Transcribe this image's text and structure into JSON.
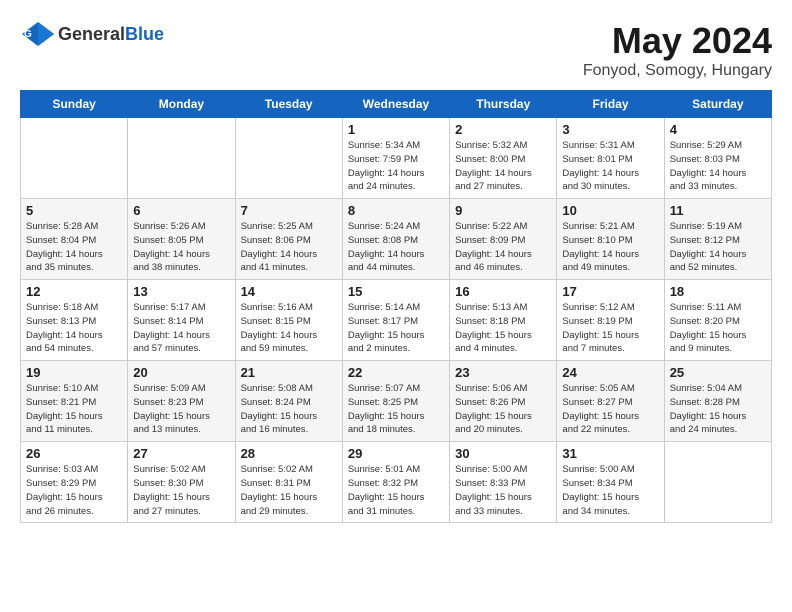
{
  "logo": {
    "general": "General",
    "blue": "Blue"
  },
  "title": "May 2024",
  "subtitle": "Fonyod, Somogy, Hungary",
  "days_of_week": [
    "Sunday",
    "Monday",
    "Tuesday",
    "Wednesday",
    "Thursday",
    "Friday",
    "Saturday"
  ],
  "weeks": [
    [
      {
        "day": "",
        "info": ""
      },
      {
        "day": "",
        "info": ""
      },
      {
        "day": "",
        "info": ""
      },
      {
        "day": "1",
        "info": "Sunrise: 5:34 AM\nSunset: 7:59 PM\nDaylight: 14 hours\nand 24 minutes."
      },
      {
        "day": "2",
        "info": "Sunrise: 5:32 AM\nSunset: 8:00 PM\nDaylight: 14 hours\nand 27 minutes."
      },
      {
        "day": "3",
        "info": "Sunrise: 5:31 AM\nSunset: 8:01 PM\nDaylight: 14 hours\nand 30 minutes."
      },
      {
        "day": "4",
        "info": "Sunrise: 5:29 AM\nSunset: 8:03 PM\nDaylight: 14 hours\nand 33 minutes."
      }
    ],
    [
      {
        "day": "5",
        "info": "Sunrise: 5:28 AM\nSunset: 8:04 PM\nDaylight: 14 hours\nand 35 minutes."
      },
      {
        "day": "6",
        "info": "Sunrise: 5:26 AM\nSunset: 8:05 PM\nDaylight: 14 hours\nand 38 minutes."
      },
      {
        "day": "7",
        "info": "Sunrise: 5:25 AM\nSunset: 8:06 PM\nDaylight: 14 hours\nand 41 minutes."
      },
      {
        "day": "8",
        "info": "Sunrise: 5:24 AM\nSunset: 8:08 PM\nDaylight: 14 hours\nand 44 minutes."
      },
      {
        "day": "9",
        "info": "Sunrise: 5:22 AM\nSunset: 8:09 PM\nDaylight: 14 hours\nand 46 minutes."
      },
      {
        "day": "10",
        "info": "Sunrise: 5:21 AM\nSunset: 8:10 PM\nDaylight: 14 hours\nand 49 minutes."
      },
      {
        "day": "11",
        "info": "Sunrise: 5:19 AM\nSunset: 8:12 PM\nDaylight: 14 hours\nand 52 minutes."
      }
    ],
    [
      {
        "day": "12",
        "info": "Sunrise: 5:18 AM\nSunset: 8:13 PM\nDaylight: 14 hours\nand 54 minutes."
      },
      {
        "day": "13",
        "info": "Sunrise: 5:17 AM\nSunset: 8:14 PM\nDaylight: 14 hours\nand 57 minutes."
      },
      {
        "day": "14",
        "info": "Sunrise: 5:16 AM\nSunset: 8:15 PM\nDaylight: 14 hours\nand 59 minutes."
      },
      {
        "day": "15",
        "info": "Sunrise: 5:14 AM\nSunset: 8:17 PM\nDaylight: 15 hours\nand 2 minutes."
      },
      {
        "day": "16",
        "info": "Sunrise: 5:13 AM\nSunset: 8:18 PM\nDaylight: 15 hours\nand 4 minutes."
      },
      {
        "day": "17",
        "info": "Sunrise: 5:12 AM\nSunset: 8:19 PM\nDaylight: 15 hours\nand 7 minutes."
      },
      {
        "day": "18",
        "info": "Sunrise: 5:11 AM\nSunset: 8:20 PM\nDaylight: 15 hours\nand 9 minutes."
      }
    ],
    [
      {
        "day": "19",
        "info": "Sunrise: 5:10 AM\nSunset: 8:21 PM\nDaylight: 15 hours\nand 11 minutes."
      },
      {
        "day": "20",
        "info": "Sunrise: 5:09 AM\nSunset: 8:23 PM\nDaylight: 15 hours\nand 13 minutes."
      },
      {
        "day": "21",
        "info": "Sunrise: 5:08 AM\nSunset: 8:24 PM\nDaylight: 15 hours\nand 16 minutes."
      },
      {
        "day": "22",
        "info": "Sunrise: 5:07 AM\nSunset: 8:25 PM\nDaylight: 15 hours\nand 18 minutes."
      },
      {
        "day": "23",
        "info": "Sunrise: 5:06 AM\nSunset: 8:26 PM\nDaylight: 15 hours\nand 20 minutes."
      },
      {
        "day": "24",
        "info": "Sunrise: 5:05 AM\nSunset: 8:27 PM\nDaylight: 15 hours\nand 22 minutes."
      },
      {
        "day": "25",
        "info": "Sunrise: 5:04 AM\nSunset: 8:28 PM\nDaylight: 15 hours\nand 24 minutes."
      }
    ],
    [
      {
        "day": "26",
        "info": "Sunrise: 5:03 AM\nSunset: 8:29 PM\nDaylight: 15 hours\nand 26 minutes."
      },
      {
        "day": "27",
        "info": "Sunrise: 5:02 AM\nSunset: 8:30 PM\nDaylight: 15 hours\nand 27 minutes."
      },
      {
        "day": "28",
        "info": "Sunrise: 5:02 AM\nSunset: 8:31 PM\nDaylight: 15 hours\nand 29 minutes."
      },
      {
        "day": "29",
        "info": "Sunrise: 5:01 AM\nSunset: 8:32 PM\nDaylight: 15 hours\nand 31 minutes."
      },
      {
        "day": "30",
        "info": "Sunrise: 5:00 AM\nSunset: 8:33 PM\nDaylight: 15 hours\nand 33 minutes."
      },
      {
        "day": "31",
        "info": "Sunrise: 5:00 AM\nSunset: 8:34 PM\nDaylight: 15 hours\nand 34 minutes."
      },
      {
        "day": "",
        "info": ""
      }
    ]
  ]
}
